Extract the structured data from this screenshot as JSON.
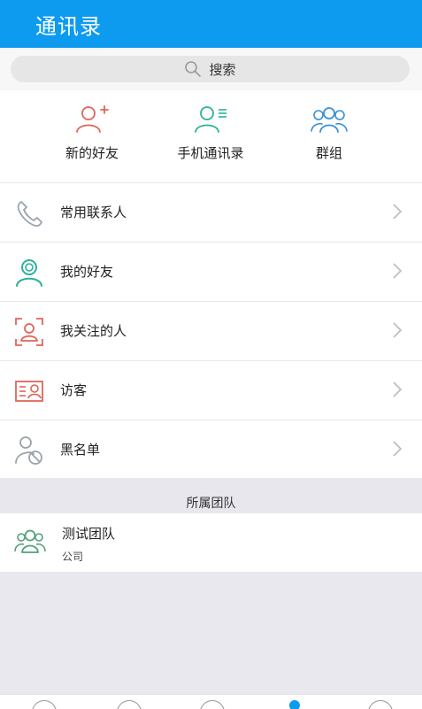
{
  "header": {
    "title": "通讯录"
  },
  "search": {
    "placeholder": "搜索"
  },
  "quick_actions": [
    {
      "label": "新的好友",
      "icon": "add-user-icon"
    },
    {
      "label": "手机通讯录",
      "icon": "contact-list-icon"
    },
    {
      "label": "群组",
      "icon": "group-icon"
    }
  ],
  "list": [
    {
      "label": "常用联系人",
      "icon": "phone-icon"
    },
    {
      "label": "我的好友",
      "icon": "friends-icon"
    },
    {
      "label": "我关注的人",
      "icon": "followed-user-icon"
    },
    {
      "label": "访客",
      "icon": "visitor-card-icon"
    },
    {
      "label": "黑名单",
      "icon": "blocked-user-icon"
    }
  ],
  "team_section": {
    "title": "所属团队",
    "teams": [
      {
        "name": "测试团队",
        "subtitle": "公司"
      }
    ]
  },
  "colors": {
    "header": "#0d9bf0",
    "red_icon": "#e0645a",
    "teal_icon": "#2ab29a",
    "blue_icon": "#3b8fd6",
    "gray_icon": "#9aa3ad",
    "green_icon": "#52a27a"
  }
}
